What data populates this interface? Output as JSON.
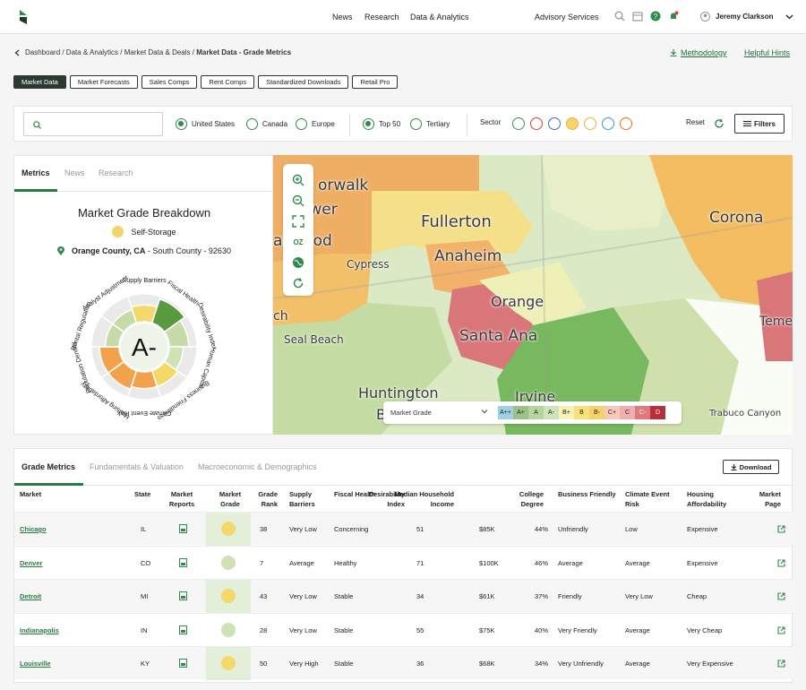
{
  "nav": {
    "links": [
      "News",
      "Research",
      "Data & Analytics"
    ],
    "advisory": "Advisory Services",
    "user": "Jeremy Clarkson"
  },
  "breadcrumb": {
    "path": "Dashboard / Data & Analytics / Market Data & Deals / ",
    "current": "Market Data - Grade Metrics",
    "methodology": "Methodology",
    "hints": "Helpful Hints"
  },
  "tabs": [
    "Market Data",
    "Market Forecasts",
    "Sales Comps",
    "Rent Comps",
    "Standardized Downloads",
    "Retail Pro"
  ],
  "filters": {
    "search_placeholder": "",
    "regions": [
      "United States",
      "Canada",
      "Europe"
    ],
    "tiers": [
      "Top 50",
      "Tertiary"
    ],
    "sector_label": "Sector",
    "reset": "Reset",
    "filters": "Filters"
  },
  "left": {
    "tabs": [
      "Metrics",
      "News",
      "Research"
    ],
    "title": "Market Grade Breakdown",
    "property": "Self-Storage",
    "location_bold": "Orange County, CA",
    "location_rest": " - South County - 92630",
    "grade": "A-",
    "wheel_labels": [
      "Supply Barriers",
      "Fiscal Health",
      "Desirability Index",
      "Human Capital",
      "Business Friendliness",
      "Climate Event Risk",
      "Housing Affordability",
      "Population Density",
      "Rental Regulation",
      "Analyst Adjustment"
    ],
    "wheel_values": [
      0.6,
      0.9,
      0.7,
      0.5,
      0.6,
      0.6,
      0.7,
      0.7,
      0.5,
      0.5
    ]
  },
  "map": {
    "labels": [
      "orwalk",
      "ower",
      "akwood",
      "Fullerton",
      "Anaheim",
      "Cypress",
      "Orange",
      "Corona",
      "Santa Ana",
      "Seal Beach",
      "Huntington",
      "Beach",
      "Irvine",
      "Trabuco Canyon",
      "Teme",
      "ch"
    ],
    "legend_select": "Market Grade",
    "grades": [
      "A++",
      "A+",
      "A",
      "A-",
      "B+",
      "B",
      "B-",
      "C+",
      "C",
      "C-",
      "D"
    ],
    "grade_colors": [
      "#9fd0e6",
      "#9cc28a",
      "#b6d59d",
      "#cfe3bb",
      "#f6f2b8",
      "#f7e27a",
      "#f5d36a",
      "#f6c9b9",
      "#f0aeb0",
      "#de7a7a",
      "#b6303b"
    ]
  },
  "bottom": {
    "tabs": [
      "Grade Metrics",
      "Fundamentals & Valuation",
      "Macroeconomic & Demographics"
    ],
    "download": "Download",
    "headers": [
      "Market",
      "State",
      "Market Reports",
      "Market Grade",
      "Grade Rank",
      "Supply Barriers",
      "Fiscal Health",
      "Desirability Index",
      "Median Household Income",
      "College Degree",
      "Business Friendly",
      "Climate Event Risk",
      "Housing Affordability",
      "Market Page"
    ],
    "rows": [
      {
        "market": "Chicago",
        "state": "IL",
        "grade": "B",
        "rank": "38",
        "supply": "Very Low",
        "fiscal": "Concerning",
        "desir": "51",
        "income": "$85K",
        "college": "44%",
        "business": "Unfriendly",
        "climate": "Low",
        "housing": "Expensive"
      },
      {
        "market": "Denver",
        "state": "CO",
        "grade": "A-",
        "rank": "7",
        "supply": "Average",
        "fiscal": "Healthy",
        "desir": "71",
        "income": "$100K",
        "college": "46%",
        "business": "Average",
        "climate": "Average",
        "housing": "Expensive"
      },
      {
        "market": "Detroit",
        "state": "MI",
        "grade": "B",
        "rank": "43",
        "supply": "Very Low",
        "fiscal": "Stable",
        "desir": "34",
        "income": "$61K",
        "college": "37%",
        "business": "Friendly",
        "climate": "Very Low",
        "housing": "Cheap"
      },
      {
        "market": "Indianapolis",
        "state": "IN",
        "grade": "A-",
        "rank": "28",
        "supply": "Very Low",
        "fiscal": "Stable",
        "desir": "55",
        "income": "$75K",
        "college": "40%",
        "business": "Very Friendly",
        "climate": "Average",
        "housing": "Very Cheap"
      },
      {
        "market": "Louisville",
        "state": "KY",
        "grade": "B",
        "rank": "50",
        "supply": "Very High",
        "fiscal": "Stable",
        "desir": "36",
        "income": "$68K",
        "college": "34%",
        "business": "Very Unfriendly",
        "climate": "Average",
        "housing": "Very Expensive"
      }
    ]
  }
}
